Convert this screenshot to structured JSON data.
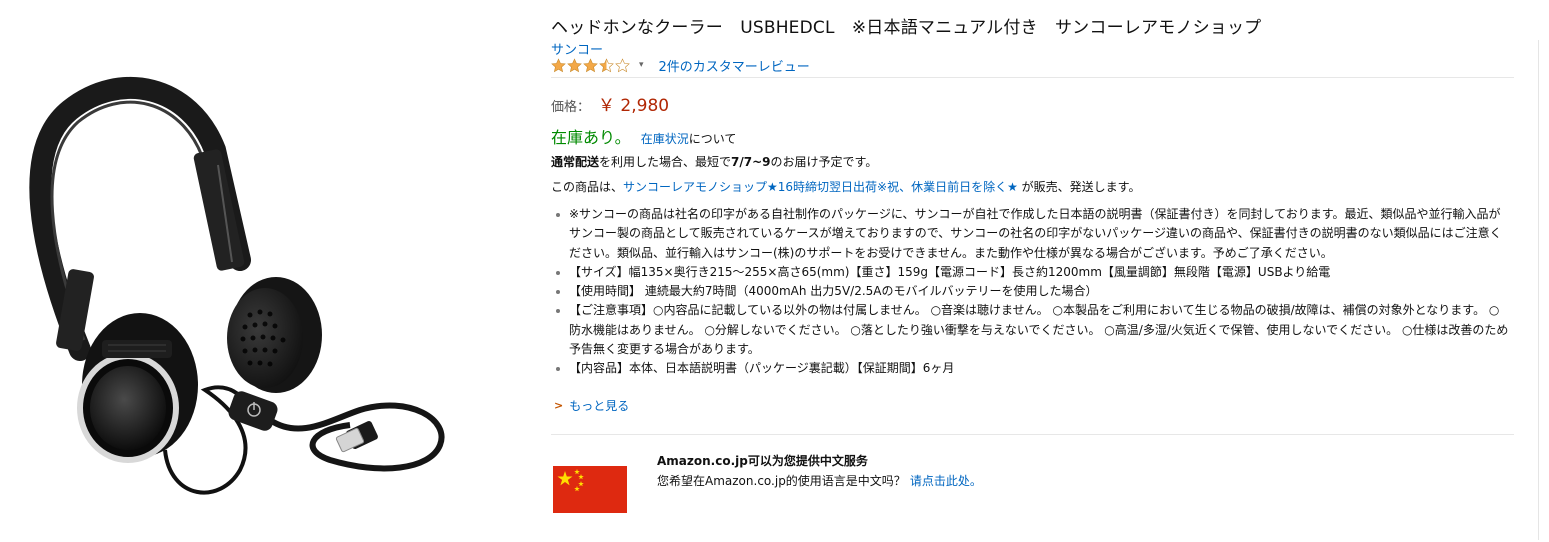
{
  "product": {
    "title": "ヘッドホンなクーラー　USBHEDCL　※日本語マニュアル付き　サンコーレアモノショップ",
    "brand": "サンコー",
    "rating_stars": 3.5,
    "rating_caret": "▾",
    "review_count_label": "2件のカスタマーレビュー"
  },
  "price": {
    "label": "価格：",
    "value": "￥ 2,980"
  },
  "stock": {
    "status": "在庫あり。",
    "link": "在庫状況",
    "after": "について"
  },
  "delivery": {
    "bold_prefix": "通常配送",
    "text_a": "を利用した場合、最短で",
    "bold_date": "7/7~9",
    "text_b": "のお届け予定です。"
  },
  "seller": {
    "prefix": "この商品は、",
    "name": "サンコーレアモノショップ★16時締切翌日出荷※祝、休業日前日を除く★",
    "suffix": " が販売、発送します。"
  },
  "bullets": [
    "※サンコーの商品は社名の印字がある自社制作のパッケージに、サンコーが自社で作成した日本語の説明書（保証書付き）を同封しております。最近、類似品や並行輸入品がサンコー製の商品として販売されているケースが増えておりますので、サンコーの社名の印字がないパッケージ違いの商品や、保証書付きの説明書のない類似品にはご注意ください。類似品、並行輸入はサンコー(株)のサポートをお受けできません。また動作や仕様が異なる場合がございます。予めご了承ください。",
    "【サイズ】幅135×奥行き215～255×高さ65(mm)【重さ】159g【電源コード】長さ約1200mm【風量調節】無段階【電源】USBより給電",
    "【使用時間】 連続最大約7時間（4000mAh 出力5V/2.5Aのモバイルバッテリーを使用した場合）",
    "【ご注意事項】○内容品に記載している以外の物は付属しません。 ○音楽は聴けません。 ○本製品をご利用において生じる物品の破損/故障は、補償の対象外となります。 ○防水機能はありません。 ○分解しないでください。 ○落としたり強い衝撃を与えないでください。 ○高温/多湿/火気近くで保管、使用しないでください。 ○仕様は改善のため予告無く変更する場合があります。",
    "【内容品】本体、日本語説明書（パッケージ裏記載）【保証期間】6ヶ月"
  ],
  "more": {
    "chevron": ">",
    "label": "もっと見る"
  },
  "chinese_service": {
    "title": "Amazon.co.jp可以为您提供中文服务",
    "question": "您希望在Amazon.co.jp的使用语言是中文吗？",
    "link": "请点击此处。",
    "flag": "china-flag"
  },
  "colors": {
    "link": "#0066c0",
    "price": "#b12704",
    "in_stock": "#008a00",
    "star": "#f3a847",
    "flag_red": "#de2910",
    "flag_yellow": "#ffde00"
  }
}
